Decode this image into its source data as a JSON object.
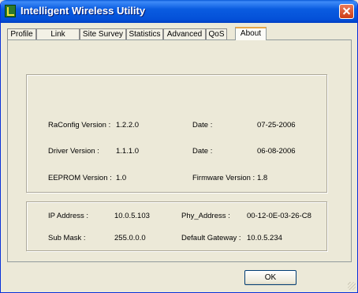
{
  "window": {
    "title": "Intelligent Wireless Utility",
    "app_icon": "wireless-utility-app-icon",
    "close_icon": "close-icon"
  },
  "tabs": [
    {
      "label": "Profile",
      "active": false
    },
    {
      "label": "Link Status",
      "active": false
    },
    {
      "label": "Site Survey",
      "active": false
    },
    {
      "label": "Statistics",
      "active": false
    },
    {
      "label": "Advanced",
      "active": false
    },
    {
      "label": "QoS",
      "active": false
    },
    {
      "label": "About",
      "active": true
    }
  ],
  "version_info": {
    "raconfig_label": "RaConfig Version :",
    "raconfig_value": "1.2.2.0",
    "raconfig_date_label": "Date :",
    "raconfig_date_value": "07-25-2006",
    "driver_label": "Driver Version :",
    "driver_value": "1.1.1.0",
    "driver_date_label": "Date :",
    "driver_date_value": "06-08-2006",
    "eeprom_label": "EEPROM Version :",
    "eeprom_value": "1.0",
    "firmware_label": "Firmware Version :",
    "firmware_value": "1.8"
  },
  "network_info": {
    "ip_label": "IP Address :",
    "ip_value": "10.0.5.103",
    "phy_label": "Phy_Address :",
    "phy_value": "00-12-0E-03-26-C8",
    "mask_label": "Sub Mask :",
    "mask_value": "255.0.0.0",
    "gateway_label": "Default Gateway :",
    "gateway_value": "10.0.5.234"
  },
  "buttons": {
    "ok_label": "OK"
  },
  "colors": {
    "titlebar": "#0450d8",
    "window_bg": "#ece9d8",
    "active_tab_accent": "#e6a74a"
  }
}
